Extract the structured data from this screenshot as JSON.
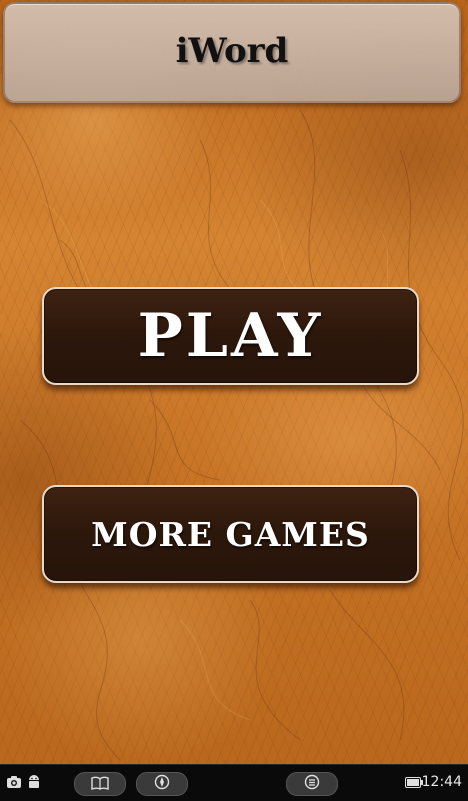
{
  "app": {
    "title": "iWord"
  },
  "menu": {
    "play_label": "PLAY",
    "more_games_label": "MORE GAMES"
  },
  "status_bar": {
    "time": "12:44",
    "icons": [
      "camera-icon",
      "android-icon",
      "book-icon",
      "compass-icon",
      "menu-icon",
      "battery-icon"
    ]
  },
  "colors": {
    "background": "#c9731f",
    "button_fill": "#2c170b",
    "button_border": "#e9d9c6",
    "title_bar": "#cdbdb2"
  }
}
